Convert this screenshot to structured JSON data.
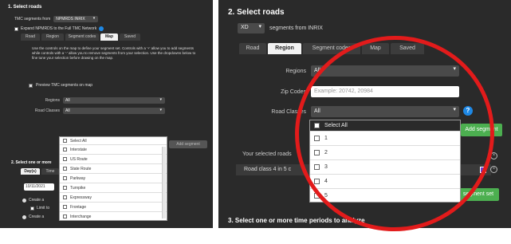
{
  "left": {
    "title": "1. Select roads",
    "tmc_label": "TMC segments from",
    "tmc_value": "NPMRDS INRIX",
    "expand_label": "Expand NPMRDS to the Full TMC Network",
    "tabs": [
      "Road",
      "Region",
      "Segment codes",
      "Map",
      "Saved"
    ],
    "instructions": "Use the controls on the map to define your segment set. Controls with a '+' allow you to add segments while controls with a '-' allow you to remove segments from your selection. Use the dropdowns below to fine tune your selection before drawing on the map.",
    "preview_label": "Preview TMC segments on map",
    "regions_label": "Regions",
    "regions_value": "All",
    "road_classes_label": "Road Classes",
    "road_classes_value": "All",
    "add_button": "Add segment",
    "select_all": "Select All",
    "options": [
      "Interstate",
      "US Route",
      "State Route",
      "Parkway",
      "Turnpike",
      "Expressway",
      "Frontage",
      "Interchange"
    ],
    "section2_title": "2. Select one or more",
    "sub_tabs": [
      "Day(s)",
      "Time"
    ],
    "date_value": "10/11/2021",
    "create_a": "Create a",
    "limit_to": "Limit to",
    "create_b": "Create a"
  },
  "right": {
    "title": "2. Select roads",
    "xd_value": "XD",
    "segments_label": "segments from INRIX",
    "tabs": [
      "Road",
      "Region",
      "Segment codes",
      "Map",
      "Saved"
    ],
    "regions_label": "Regions",
    "regions_value": "All",
    "zip_label": "Zip Codes",
    "zip_placeholder": "Example: 20742, 20984",
    "road_classes_label": "Road Classes",
    "road_classes_value": "All",
    "select_all": "Select All",
    "options": [
      "1",
      "2",
      "3",
      "4",
      "5"
    ],
    "add_button": "Add segment",
    "selected_label": "Your selected roads",
    "selected_item": "Road class 4 in 5 c",
    "segment_set_button": "segment set",
    "section3_title": "3. Select one or more time periods to analyze"
  },
  "accent_green": "#4caf50",
  "annotation_color": "#e21b1b"
}
